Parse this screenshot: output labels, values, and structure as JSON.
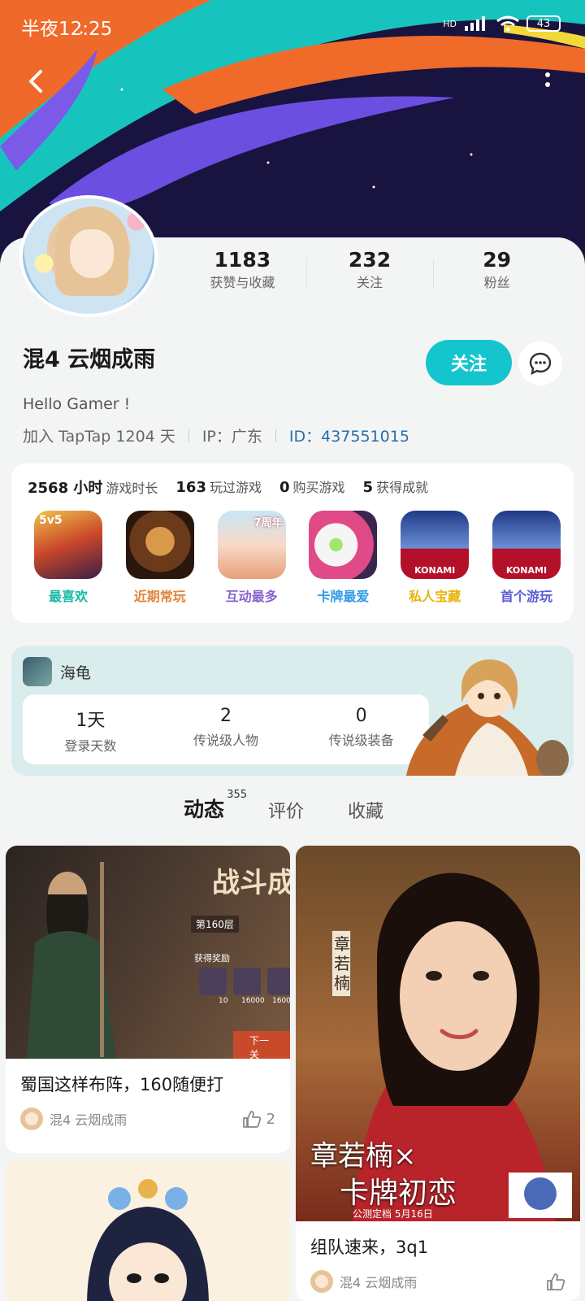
{
  "status": {
    "time": "半夜12:25",
    "battery": "43",
    "hd": "HD"
  },
  "profile": {
    "stats": [
      {
        "value": "1183",
        "label": "获赞与收藏"
      },
      {
        "value": "232",
        "label": "关注"
      },
      {
        "value": "29",
        "label": "粉丝"
      }
    ],
    "username": "混4 云烟成雨",
    "follow_label": "关注",
    "bio": "Hello Gamer !",
    "joined": "加入 TapTap 1204 天",
    "ip": "IP：广东",
    "uid": "ID：437551015"
  },
  "game_summary": {
    "hours_value": "2568 小时",
    "hours_label": "游戏时长",
    "played_value": "163",
    "played_label": "玩过游戏",
    "bought_value": "0",
    "bought_label": "购买游戏",
    "achievements_value": "5",
    "achievements_label": "获得成就",
    "games": [
      {
        "tag": "最喜欢",
        "color": "#14b8a6",
        "icon_text": "5v5"
      },
      {
        "tag": "近期常玩",
        "color": "#e0843a",
        "icon_text": ""
      },
      {
        "tag": "互动最多",
        "color": "#8a63d2",
        "icon_text": "7周年"
      },
      {
        "tag": "卡牌最爱",
        "color": "#2f9be8",
        "icon_text": ""
      },
      {
        "tag": "私人宝藏",
        "color": "#eab308",
        "icon_text": "KONAMI"
      },
      {
        "tag": "首个游玩",
        "color": "#5b5bd6",
        "icon_text": "KONAMI"
      }
    ]
  },
  "turtle": {
    "name": "海龟",
    "stats": [
      {
        "value": "1天",
        "label": "登录天数"
      },
      {
        "value": "2",
        "label": "传说级人物"
      },
      {
        "value": "0",
        "label": "传说级装备"
      }
    ]
  },
  "tabs": [
    {
      "label": "动态",
      "count": "355"
    },
    {
      "label": "评价"
    },
    {
      "label": "收藏"
    }
  ],
  "posts": [
    {
      "title": "蜀国这样布阵，160随便打",
      "author": "混4 云烟成雨",
      "likes": "2",
      "img_text": {
        "header": "战斗成",
        "level": "第160层",
        "reward": "获得奖励",
        "next": "下一关",
        "n1": "10",
        "n2": "16000",
        "n3": "1600"
      }
    },
    {
      "title": "组队速来，3q1",
      "author": "混4 云烟成雨",
      "likes": "",
      "img_text": {
        "name_v": "章若楠",
        "promo1": "章若楠×",
        "promo2": "卡牌初恋",
        "date": "公测定档 5月16日"
      }
    },
    {
      "title": "",
      "author": "",
      "likes": ""
    }
  ]
}
